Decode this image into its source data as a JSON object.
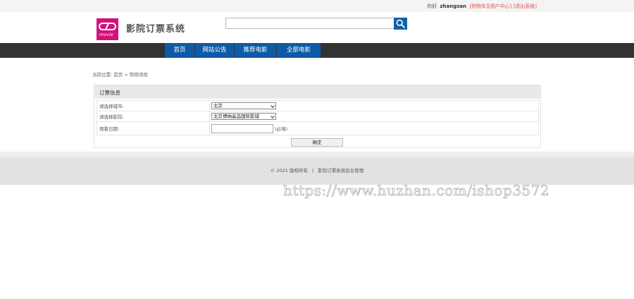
{
  "topbar": {
    "greeting": "你好",
    "username": "zhangsan",
    "links": [
      "[购物车]",
      "[用户中心]",
      "[退出系统]"
    ]
  },
  "header": {
    "logo_text": "movie",
    "site_title": "影院订票系统",
    "search_placeholder": ""
  },
  "nav": {
    "items": [
      "首页",
      "网站公告",
      "推荐电影",
      "全部电影"
    ]
  },
  "breadcrumb": "当前位置: 首页 > 购物流程",
  "order": {
    "panel_title": "订票信息",
    "city_label": "请选择城市:",
    "city_value": "北京",
    "cinema_label": "请选择影院:",
    "cinema_value": "北京博纳晶品国际影城",
    "date_label": "观看日期:",
    "date_value": "",
    "required_note": "(必填)",
    "confirm_label": "确定"
  },
  "footer": {
    "copyright": "© 2021 版权所有",
    "separator": "|",
    "admin_link": "影院订票系统后台管理"
  },
  "watermark": "https://www.huzhan.com/ishop3572",
  "colors": {
    "nav_active": "#0e5aa7",
    "nav_bar": "#333333",
    "logo_bg": "#d1127b",
    "link_red": "#d9534f"
  }
}
